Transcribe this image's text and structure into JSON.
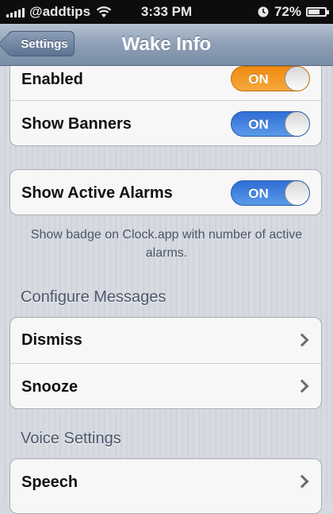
{
  "status_bar": {
    "carrier": "@addtips",
    "time": "3:33 PM",
    "battery": "72%",
    "battery_level": 0.72,
    "icons": [
      "signal-icon",
      "wifi-icon",
      "alarm-clock-icon",
      "battery-icon"
    ]
  },
  "nav": {
    "back_label": "Settings",
    "title": "Wake Info"
  },
  "group1": {
    "enabled_label": "Enabled",
    "enabled_state": "ON",
    "banners_label": "Show Banners",
    "banners_state": "ON"
  },
  "group2": {
    "alarms_label": "Show Active Alarms",
    "alarms_state": "ON",
    "footer": "Show badge on Clock.app with number of active alarms."
  },
  "configure": {
    "header": "Configure Messages",
    "items": [
      {
        "label": "Dismiss"
      },
      {
        "label": "Snooze"
      }
    ]
  },
  "voice": {
    "header": "Voice Settings",
    "items": [
      {
        "label": "Speech"
      }
    ]
  },
  "colors": {
    "switch_on_blue": "#2f6ed6",
    "switch_on_orange": "#f08a10",
    "nav_bar": "#8d9eb5"
  }
}
